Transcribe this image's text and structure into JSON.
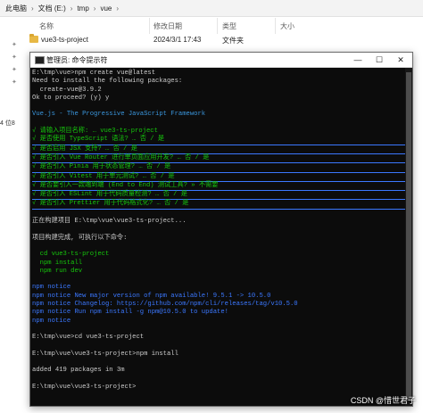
{
  "explorer": {
    "breadcrumbs": [
      "此电脑",
      "文档 (E:)",
      "tmp",
      "vue"
    ],
    "separator": "›",
    "columns": {
      "name": "名称",
      "date": "修改日期",
      "type": "类型",
      "size": "大小"
    },
    "file": {
      "name": "vue3-ts-project",
      "date": "2024/3/1 17:43",
      "type": "文件夹"
    },
    "left_label": "4 位8"
  },
  "cmd": {
    "title": "管理员: 命令提示符",
    "buttons": {
      "minimize": "—",
      "maximize": "☐",
      "close": "✕"
    },
    "lines": [
      "E:\\tmp\\vue>npm create vue@latest",
      "Need to install the following packages:",
      "  create-vue@3.9.2",
      "Ok to proceed? (y) y",
      "",
      "Vue.js - The Progressive JavaScript Framework",
      "",
      "√ 请输入项目名称: … vue3-ts-project",
      "√ 是否使用 TypeScript 语法? … 否 / 是",
      "√ 是否启用 JSX 支持? … 否 / 是",
      "√ 是否引入 Vue Router 进行单页面应用开发? … 否 / 是",
      "√ 是否引入 Pinia 用于状态管理? … 否 / 是",
      "√ 是否引入 Vitest 用于单元测试? … 否 / 是",
      "√ 是否要引入一款端到端 (End to End) 测试工具? » 不需要",
      "√ 是否引入 ESLint 用于代码质量检测? … 否 / 是",
      "√ 是否引入 Prettier 用于代码格式化? … 否 / 是",
      "",
      "正在构建项目 E:\\tmp\\vue\\vue3-ts-project...",
      "",
      "项目构建完成, 可执行以下命令:",
      "",
      "  cd vue3-ts-project",
      "  npm install",
      "  npm run dev",
      "",
      "npm notice",
      "npm notice New major version of npm available! 9.5.1 -> 10.5.0",
      "npm notice Changelog: https://github.com/npm/cli/releases/tag/v10.5.0",
      "npm notice Run npm install -g npm@10.5.0 to update!",
      "npm notice",
      "",
      "E:\\tmp\\vue>cd vue3-ts-project",
      "",
      "E:\\tmp\\vue\\vue3-ts-project>npm install",
      "",
      "added 419 packages in 3m",
      "",
      "E:\\tmp\\vue\\vue3-ts-project>"
    ]
  },
  "watermark": "CSDN @惜世君子",
  "colors": {
    "terminal_bg": "#0c0c0c",
    "terminal_text": "#cccccc",
    "green": "#16c60c",
    "cyan": "#3a96dd",
    "blue": "#3b78ff"
  }
}
